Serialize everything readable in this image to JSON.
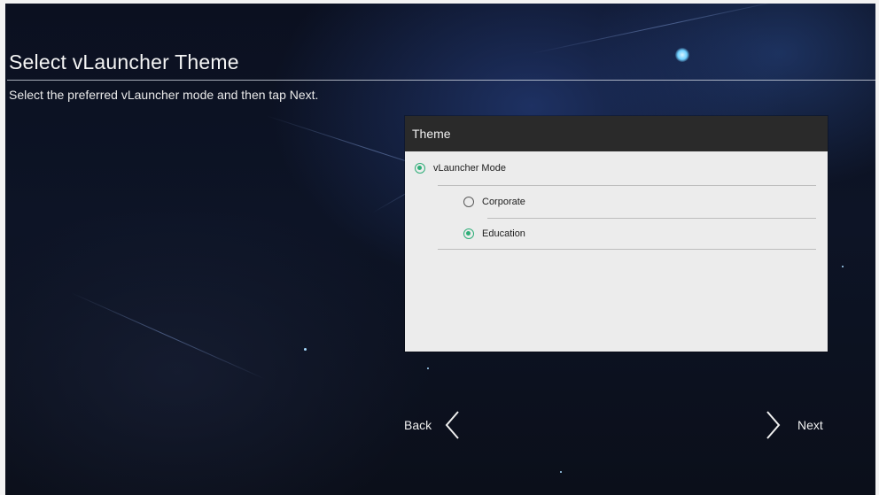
{
  "screen": {
    "title": "Select vLauncher Theme",
    "description": "Select the preferred vLauncher mode and then tap Next."
  },
  "theme_panel": {
    "header": "Theme",
    "mode_option": {
      "label": "vLauncher Mode",
      "selected": true
    },
    "sub_options": [
      {
        "label": "Corporate",
        "selected": false
      },
      {
        "label": "Education",
        "selected": true
      }
    ]
  },
  "navigation": {
    "back_label": "Back",
    "next_label": "Next"
  },
  "colors": {
    "accent_radio": "#2fae78",
    "panel_header": "#2a2a2a",
    "panel_body": "#ececec"
  },
  "icons": {
    "back": "chevron-left-icon",
    "next": "chevron-right-icon"
  }
}
